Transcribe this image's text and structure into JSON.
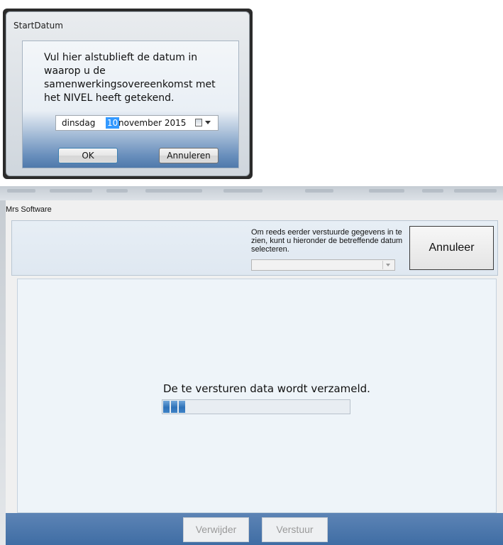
{
  "start_dialog": {
    "title": "StartDatum",
    "message": "Vul hier alstublieft de datum in waarop u de samenwerkingsovereenkomst met het NIVEL heeft getekend.",
    "date_picker": {
      "weekday": "dinsdag",
      "day": "10",
      "month_year": "november 2015",
      "icon": "calendar-icon"
    },
    "ok_label": "OK",
    "cancel_label": "Annuleren"
  },
  "main_window": {
    "title": "Mrs Software",
    "info_text": "Om reeds eerder verstuurde gegevens in te zien, kunt u hieronder de betreffende datum selecteren.",
    "date_select_value": "",
    "cancel_label": "Annuleer",
    "status_text": "De te versturen data wordt verzameld.",
    "progress_segments": 3,
    "buttons": {
      "delete_label": "Verwijder",
      "send_label": "Verstuur"
    }
  },
  "colors": {
    "accent_blue": "#3e82c6",
    "footer_blue": "#4f79ab",
    "selection_blue": "#3399ff",
    "disabled_text": "#9a9a9a"
  }
}
